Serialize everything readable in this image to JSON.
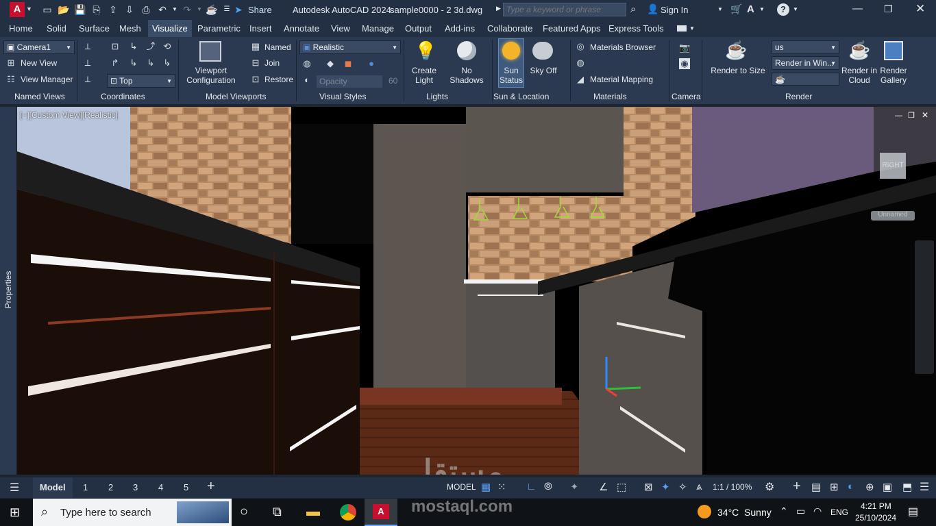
{
  "app": {
    "title": "Autodesk AutoCAD 2024",
    "file": "sample0000 - 2 3d.dwg",
    "search_placeholder": "Type a keyword or phrase",
    "sign_in": "Sign In",
    "share": "Share"
  },
  "tabs": [
    "Home",
    "Solid",
    "Surface",
    "Mesh",
    "Visualize",
    "Parametric",
    "Insert",
    "Annotate",
    "View",
    "Manage",
    "Output",
    "Add-ins",
    "Collaborate",
    "Featured Apps",
    "Express Tools"
  ],
  "active_tab": "Visualize",
  "ribbon": {
    "named_views": {
      "camera": "Camera1",
      "new_view": "New View",
      "view_manager": "View Manager",
      "panel": "Named Views"
    },
    "coordinates": {
      "ucs": "Top",
      "panel": "Coordinates"
    },
    "model_viewports": {
      "config": "Viewport Configuration",
      "named": "Named",
      "join": "Join",
      "restore": "Restore",
      "panel": "Model Viewports"
    },
    "visual_styles": {
      "style": "Realistic",
      "opacity_label": "Opacity",
      "opacity_value": "60",
      "panel": "Visual Styles"
    },
    "lights": {
      "create": "Create Light",
      "no_shadows": "No Shadows",
      "panel": "Lights"
    },
    "sun": {
      "status": "Sun Status",
      "sky": "Sky Off",
      "panel": "Sun & Location"
    },
    "materials": {
      "browser": "Materials Browser",
      "mapping": "Material Mapping",
      "panel": "Materials"
    },
    "camera": {
      "panel": "Camera"
    },
    "render": {
      "preset": "us",
      "target": "Render in Win...",
      "render_to_size": "Render to Size",
      "cloud": "Render in Cloud",
      "gallery": "Render Gallery",
      "panel": "Render"
    }
  },
  "viewport": {
    "label": "[−][Custom View][Realistic]",
    "viewcube": "RIGHT",
    "unnamed": "Unnamed",
    "properties": "Properties"
  },
  "layout_tabs": [
    "Model",
    "1",
    "2",
    "3",
    "4",
    "5"
  ],
  "status": {
    "model": "MODEL",
    "scale": "1:1 / 100%"
  },
  "taskbar": {
    "search_placeholder": "Type here to search",
    "weather": "34°C  Sunny",
    "lang": "ENG",
    "time": "4:21 PM",
    "date": "25/10/2024"
  },
  "watermark": {
    "arabic": "مستقل",
    "latin": "mostaql.com"
  }
}
